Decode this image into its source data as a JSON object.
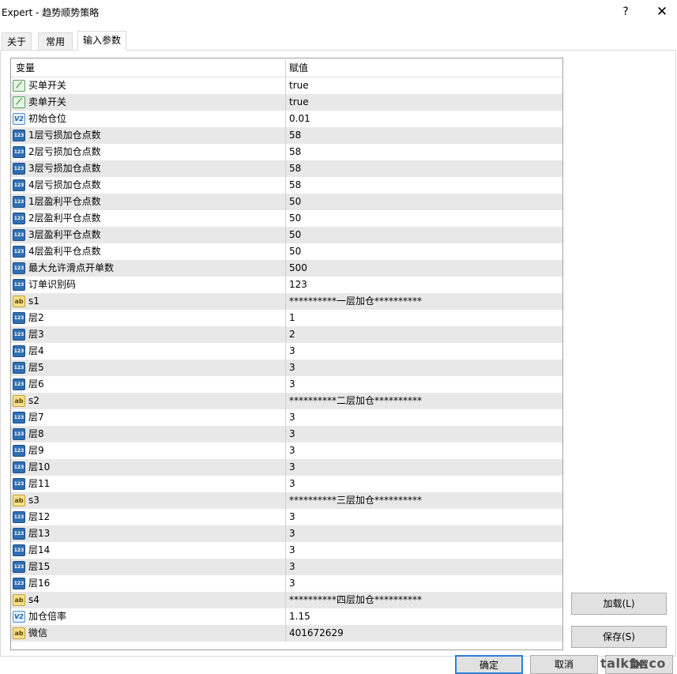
{
  "window": {
    "title": "Expert - 趋势顺势策略",
    "help": "?",
    "close": "✕"
  },
  "tabs": [
    {
      "label": "关于",
      "active": false
    },
    {
      "label": "常用",
      "active": false
    },
    {
      "label": "输入参数",
      "active": true
    }
  ],
  "grid": {
    "headers": {
      "name": "变量",
      "value": "赋值"
    },
    "rows": [
      {
        "icon": "bool",
        "name": "买单开关",
        "value": "true"
      },
      {
        "icon": "bool",
        "name": "卖单开关",
        "value": "true"
      },
      {
        "icon": "double",
        "name": "初始仓位",
        "value": "0.01"
      },
      {
        "icon": "int",
        "name": "1层亏损加仓点数",
        "value": "58"
      },
      {
        "icon": "int",
        "name": "2层亏损加仓点数",
        "value": "58"
      },
      {
        "icon": "int",
        "name": "3层亏损加仓点数",
        "value": "58"
      },
      {
        "icon": "int",
        "name": "4层亏损加仓点数",
        "value": "58"
      },
      {
        "icon": "int",
        "name": "1层盈利平仓点数",
        "value": "50"
      },
      {
        "icon": "int",
        "name": "2层盈利平仓点数",
        "value": "50"
      },
      {
        "icon": "int",
        "name": "3层盈利平仓点数",
        "value": "50"
      },
      {
        "icon": "int",
        "name": "4层盈利平仓点数",
        "value": "50"
      },
      {
        "icon": "int",
        "name": "最大允许滑点开单数",
        "value": "500"
      },
      {
        "icon": "int",
        "name": "订单识别码",
        "value": "123"
      },
      {
        "icon": "string",
        "name": "s1",
        "value": "**********一层加仓**********"
      },
      {
        "icon": "int",
        "name": "层2",
        "value": "1"
      },
      {
        "icon": "int",
        "name": "层3",
        "value": "2"
      },
      {
        "icon": "int",
        "name": "层4",
        "value": "3"
      },
      {
        "icon": "int",
        "name": "层5",
        "value": "3"
      },
      {
        "icon": "int",
        "name": "层6",
        "value": "3"
      },
      {
        "icon": "string",
        "name": "s2",
        "value": "**********二层加仓**********"
      },
      {
        "icon": "int",
        "name": "层7",
        "value": "3"
      },
      {
        "icon": "int",
        "name": "层8",
        "value": "3"
      },
      {
        "icon": "int",
        "name": "层9",
        "value": "3"
      },
      {
        "icon": "int",
        "name": "层10",
        "value": "3"
      },
      {
        "icon": "int",
        "name": "层11",
        "value": "3"
      },
      {
        "icon": "string",
        "name": "s3",
        "value": "**********三层加仓**********"
      },
      {
        "icon": "int",
        "name": "层12",
        "value": "3"
      },
      {
        "icon": "int",
        "name": "层13",
        "value": "3"
      },
      {
        "icon": "int",
        "name": "层14",
        "value": "3"
      },
      {
        "icon": "int",
        "name": "层15",
        "value": "3"
      },
      {
        "icon": "int",
        "name": "层16",
        "value": "3"
      },
      {
        "icon": "string",
        "name": "s4",
        "value": "**********四层加仓**********"
      },
      {
        "icon": "double",
        "name": "加仓倍率",
        "value": "1.15"
      },
      {
        "icon": "string",
        "name": "微信",
        "value": "401672629"
      }
    ]
  },
  "icon_glyphs": {
    "bool": "⟋",
    "double": "V2",
    "int": "123",
    "string": "ab"
  },
  "buttons": {
    "load": "加载(L)",
    "save": "保存(S)",
    "ok": "确定",
    "cancel": "取消",
    "reset": "重置"
  },
  "watermark": "talkfx.co"
}
